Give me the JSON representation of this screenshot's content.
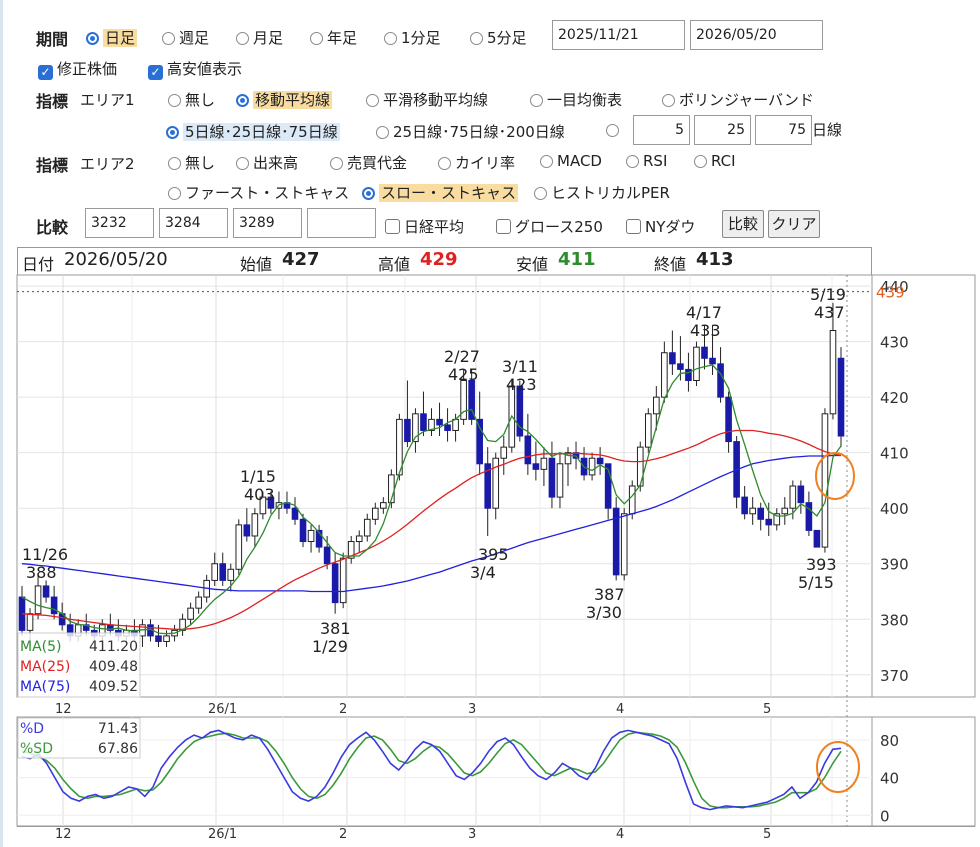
{
  "period": {
    "label": "期間",
    "options": [
      "日足",
      "週足",
      "月足",
      "年足",
      "1分足",
      "5分足"
    ],
    "selected": 0,
    "date_from": "2025/11/21",
    "date_to": "2026/05/20"
  },
  "checks": [
    {
      "label": "修正株価",
      "checked": true
    },
    {
      "label": "高安値表示",
      "checked": true
    }
  ],
  "area1": {
    "label": "指標",
    "sub": "エリア1",
    "options": [
      "無し",
      "移動平均線",
      "平滑移動平均線",
      "一目均衡表",
      "ボリンジャーバンド"
    ],
    "selected": 1,
    "ma_options": [
      "5日線･25日線･75日線",
      "25日線･75日線･200日線"
    ],
    "ma_selected": 0,
    "ma_inputs": [
      "5",
      "25",
      "75"
    ],
    "ma_unit": "日線"
  },
  "area2": {
    "label": "指標",
    "sub": "エリア2",
    "options": [
      "無し",
      "出来高",
      "売買代金",
      "カイリ率",
      "MACD",
      "RSI",
      "RCI",
      "ファースト・ストキャス",
      "スロー・ストキャス",
      "ヒストリカルPER"
    ],
    "selected": 8
  },
  "compare": {
    "label": "比較",
    "codes": [
      "3232",
      "3284",
      "3289",
      ""
    ],
    "options": [
      "日経平均",
      "グロース250",
      "NYダウ"
    ],
    "compare_button": "比較",
    "clear_button": "クリア"
  },
  "info": {
    "date_label": "日付",
    "date": "2026/05/20",
    "open_label": "始値",
    "open": "427",
    "high_label": "高値",
    "high": "429",
    "low_label": "安値",
    "low": "411",
    "close_label": "終値",
    "close": "413"
  },
  "colors": {
    "up": "#ffffff",
    "down": "#1a1aa8",
    "ma5": "#2e8b2e",
    "ma25": "#e02020",
    "ma75": "#2020e0",
    "high_red": "#e02020",
    "low_green": "#2e8b2e",
    "highlight_circle": "#f08020",
    "k_line": "#3a3ae0",
    "d_line": "#3a9a3a"
  },
  "chart_data": [
    {
      "type": "candlestick",
      "yticks": [
        370,
        380,
        390,
        400,
        410,
        420,
        430,
        440
      ],
      "ylim": [
        366,
        442
      ],
      "xticks": [
        "12",
        "26/1",
        "2",
        "3",
        "4",
        "5"
      ],
      "current_price_line": "439",
      "annotations": [
        {
          "text": "11/26",
          "value": "388"
        },
        {
          "text": "1/15",
          "value": "403"
        },
        {
          "text": "1/29",
          "value": "381"
        },
        {
          "text": "2/27",
          "value": "425"
        },
        {
          "text": "3/4",
          "value": "395"
        },
        {
          "text": "3/11",
          "value": "423"
        },
        {
          "text": "3/30",
          "value": "387"
        },
        {
          "text": "4/17",
          "value": "433"
        },
        {
          "text": "5/15",
          "value": "393"
        },
        {
          "text": "5/19",
          "value": "437"
        }
      ],
      "legend": [
        {
          "name": "MA(5)",
          "value": "411.20"
        },
        {
          "name": "MA(25)",
          "value": "409.48"
        },
        {
          "name": "MA(75)",
          "value": "409.52"
        }
      ],
      "candles": [
        [
          384,
          386,
          377,
          378
        ],
        [
          378,
          382,
          376,
          381
        ],
        [
          381,
          388,
          380,
          386
        ],
        [
          386,
          387,
          383,
          384
        ],
        [
          384,
          386,
          380,
          381
        ],
        [
          381,
          383,
          378,
          379
        ],
        [
          379,
          381,
          376,
          377
        ],
        [
          377,
          380,
          376,
          379
        ],
        [
          379,
          381,
          377,
          378
        ],
        [
          378,
          379,
          376,
          377
        ],
        [
          377,
          380,
          376,
          379
        ],
        [
          379,
          381,
          377,
          378
        ],
        [
          378,
          380,
          376,
          377
        ],
        [
          377,
          379,
          376,
          378
        ],
        [
          378,
          380,
          376,
          377
        ],
        [
          377,
          380,
          375,
          379
        ],
        [
          379,
          380,
          376,
          377
        ],
        [
          377,
          379,
          375,
          376
        ],
        [
          376,
          378,
          375,
          377
        ],
        [
          377,
          379,
          376,
          378
        ],
        [
          378,
          381,
          377,
          380
        ],
        [
          380,
          383,
          379,
          382
        ],
        [
          382,
          385,
          381,
          384
        ],
        [
          384,
          388,
          383,
          387
        ],
        [
          387,
          392,
          386,
          390
        ],
        [
          390,
          392,
          386,
          387
        ],
        [
          387,
          390,
          385,
          389
        ],
        [
          389,
          398,
          388,
          397
        ],
        [
          397,
          400,
          394,
          395
        ],
        [
          395,
          400,
          393,
          399
        ],
        [
          399,
          403,
          398,
          402
        ],
        [
          402,
          403,
          399,
          400
        ],
        [
          400,
          403,
          398,
          401
        ],
        [
          401,
          403,
          399,
          400
        ],
        [
          400,
          402,
          397,
          398
        ],
        [
          398,
          399,
          393,
          394
        ],
        [
          394,
          397,
          392,
          396
        ],
        [
          396,
          397,
          392,
          393
        ],
        [
          393,
          395,
          389,
          390
        ],
        [
          390,
          392,
          381,
          383
        ],
        [
          383,
          392,
          382,
          391
        ],
        [
          391,
          395,
          390,
          394
        ],
        [
          394,
          396,
          392,
          395
        ],
        [
          395,
          399,
          394,
          398
        ],
        [
          398,
          401,
          397,
          400
        ],
        [
          400,
          402,
          399,
          401
        ],
        [
          401,
          407,
          400,
          406
        ],
        [
          406,
          417,
          405,
          416
        ],
        [
          416,
          423,
          411,
          412
        ],
        [
          412,
          418,
          410,
          417
        ],
        [
          417,
          421,
          413,
          414
        ],
        [
          414,
          418,
          413,
          416
        ],
        [
          416,
          419,
          413,
          415
        ],
        [
          415,
          418,
          412,
          414
        ],
        [
          414,
          417,
          412,
          416
        ],
        [
          416,
          425,
          415,
          423
        ],
        [
          423,
          425,
          415,
          416
        ],
        [
          416,
          421,
          406,
          408
        ],
        [
          408,
          411,
          395,
          400
        ],
        [
          400,
          410,
          398,
          409
        ],
        [
          409,
          413,
          406,
          411
        ],
        [
          411,
          423,
          410,
          422
        ],
        [
          422,
          423,
          412,
          413
        ],
        [
          413,
          417,
          406,
          408
        ],
        [
          408,
          412,
          405,
          407
        ],
        [
          407,
          411,
          404,
          409
        ],
        [
          409,
          412,
          400,
          402
        ],
        [
          402,
          410,
          400,
          408
        ],
        [
          408,
          411,
          404,
          410
        ],
        [
          410,
          412,
          407,
          409
        ],
        [
          409,
          411,
          405,
          406
        ],
        [
          406,
          410,
          405,
          409
        ],
        [
          409,
          411,
          406,
          408
        ],
        [
          408,
          407,
          398,
          400
        ],
        [
          400,
          402,
          387,
          388
        ],
        [
          388,
          400,
          387,
          399
        ],
        [
          399,
          405,
          398,
          404
        ],
        [
          404,
          412,
          403,
          411
        ],
        [
          411,
          418,
          410,
          417
        ],
        [
          417,
          422,
          414,
          420
        ],
        [
          420,
          430,
          419,
          428
        ],
        [
          428,
          432,
          424,
          426
        ],
        [
          426,
          431,
          423,
          425
        ],
        [
          425,
          428,
          421,
          423
        ],
        [
          423,
          430,
          422,
          429
        ],
        [
          429,
          433,
          425,
          427
        ],
        [
          427,
          433,
          424,
          426
        ],
        [
          426,
          429,
          419,
          420
        ],
        [
          420,
          421,
          410,
          412
        ],
        [
          412,
          413,
          400,
          402
        ],
        [
          402,
          404,
          398,
          399
        ],
        [
          399,
          402,
          397,
          400
        ],
        [
          400,
          401,
          396,
          398
        ],
        [
          398,
          401,
          395,
          397
        ],
        [
          397,
          400,
          396,
          399
        ],
        [
          399,
          402,
          397,
          400
        ],
        [
          400,
          405,
          398,
          404
        ],
        [
          404,
          405,
          399,
          401
        ],
        [
          401,
          403,
          395,
          396
        ],
        [
          396,
          396,
          393,
          393
        ],
        [
          393,
          418,
          392,
          417
        ],
        [
          417,
          437,
          416,
          432
        ],
        [
          427,
          429,
          411,
          413
        ]
      ],
      "ma5": [
        384.0,
        383.2,
        382.5,
        382.1,
        381.8,
        381.0,
        379.6,
        379.1,
        378.9,
        378.5,
        378.3,
        378.2,
        378.4,
        378.0,
        377.9,
        378.1,
        378.2,
        377.5,
        377.4,
        377.5,
        378.1,
        379.0,
        380.4,
        382.1,
        383.6,
        384.7,
        386.0,
        387.8,
        390.8,
        393.0,
        395.5,
        398.7,
        400.6,
        401.0,
        400.5,
        398.4,
        397.2,
        395.6,
        393.8,
        392.0,
        391.4,
        391.4,
        391.4,
        392.6,
        394.2,
        397.2,
        401.6,
        406.4,
        410.2,
        412.8,
        413.8,
        414.2,
        414.5,
        415.4,
        416.0,
        417.4,
        417.8,
        414.5,
        412.2,
        412.0,
        413.3,
        416.6,
        414.6,
        413.8,
        412.4,
        410.8,
        409.3,
        410.0,
        409.5,
        409.4,
        407.4,
        406.8,
        407.8,
        407.0,
        402.4,
        400.8,
        402.2,
        404.2,
        409.4,
        414.6,
        419.7,
        422.5,
        424.3,
        424.4,
        425.1,
        425.5,
        425.8,
        424.2,
        421.6,
        415.9,
        411.5,
        406.8,
        402.4,
        399.4,
        398.6,
        398.6,
        399.1,
        400.8,
        399.9,
        398.6,
        401.0,
        409.2,
        411.2
      ],
      "ma25": [
        381.0,
        380.9,
        380.8,
        380.7,
        380.5,
        380.3,
        380.0,
        379.8,
        379.6,
        379.4,
        379.2,
        379.0,
        378.9,
        378.8,
        378.7,
        378.6,
        378.5,
        378.4,
        378.3,
        378.2,
        378.2,
        378.3,
        378.5,
        378.8,
        379.2,
        379.7,
        380.3,
        381.0,
        381.8,
        382.7,
        383.6,
        384.5,
        385.4,
        386.3,
        387.1,
        387.8,
        388.5,
        389.2,
        389.8,
        390.3,
        390.8,
        391.4,
        392.0,
        392.6,
        393.3,
        394.1,
        395.0,
        396.0,
        397.1,
        398.3,
        399.5,
        400.6,
        401.7,
        402.7,
        403.6,
        404.6,
        405.5,
        406.2,
        406.8,
        407.4,
        407.9,
        408.5,
        409.0,
        409.3,
        409.6,
        409.8,
        409.8,
        409.8,
        409.8,
        409.9,
        409.8,
        409.7,
        409.6,
        409.3,
        408.8,
        408.5,
        408.4,
        408.4,
        408.6,
        408.9,
        409.3,
        409.8,
        410.3,
        410.8,
        411.4,
        412.1,
        412.8,
        413.4,
        413.8,
        414.0,
        414.0,
        414.0,
        413.8,
        413.5,
        413.3,
        413.0,
        412.6,
        412.1,
        411.5,
        410.8,
        410.2,
        409.8,
        409.5
      ],
      "ma75": [
        390.0,
        389.9,
        389.7,
        389.6,
        389.4,
        389.2,
        389.0,
        388.8,
        388.6,
        388.4,
        388.2,
        388.0,
        387.8,
        387.6,
        387.4,
        387.2,
        387.0,
        386.8,
        386.6,
        386.4,
        386.2,
        386.0,
        385.8,
        385.6,
        385.4,
        385.3,
        385.2,
        385.1,
        385.1,
        385.1,
        385.1,
        385.1,
        385.1,
        385.1,
        385.1,
        385.1,
        385.0,
        385.0,
        385.0,
        385.0,
        385.0,
        385.2,
        385.4,
        385.6,
        385.8,
        386.0,
        386.3,
        386.6,
        386.9,
        387.3,
        387.7,
        388.1,
        388.5,
        389.0,
        389.5,
        390.0,
        390.5,
        390.9,
        391.3,
        391.8,
        392.3,
        392.8,
        393.3,
        393.8,
        394.2,
        394.6,
        395.0,
        395.4,
        395.8,
        396.2,
        396.6,
        397.0,
        397.4,
        397.8,
        398.2,
        398.6,
        399.0,
        399.4,
        399.8,
        400.3,
        400.9,
        401.5,
        402.2,
        402.9,
        403.6,
        404.3,
        405.0,
        405.7,
        406.3,
        406.9,
        407.5,
        408.0,
        408.3,
        408.6,
        408.8,
        409.0,
        409.2,
        409.3,
        409.4,
        409.4,
        409.4,
        409.5,
        409.5
      ]
    },
    {
      "type": "line",
      "title": "スロー・ストキャス",
      "yticks": [
        0,
        40,
        80
      ],
      "ylim": [
        -5,
        100
      ],
      "xticks": [
        "12",
        "26/1",
        "2",
        "3",
        "4",
        "5"
      ],
      "legend": [
        {
          "name": "%D",
          "value": "71.43"
        },
        {
          "name": "%SD",
          "value": "67.86"
        }
      ],
      "series": [
        {
          "name": "%D",
          "values": [
            62,
            60,
            65,
            55,
            40,
            25,
            18,
            15,
            20,
            22,
            18,
            20,
            25,
            30,
            28,
            20,
            30,
            50,
            62,
            72,
            80,
            85,
            82,
            88,
            90,
            86,
            82,
            80,
            85,
            82,
            70,
            55,
            40,
            25,
            18,
            15,
            20,
            30,
            45,
            62,
            75,
            82,
            88,
            80,
            68,
            55,
            48,
            58,
            70,
            78,
            75,
            68,
            55,
            42,
            38,
            45,
            55,
            68,
            78,
            82,
            75,
            62,
            50,
            42,
            38,
            45,
            55,
            50,
            42,
            38,
            50,
            68,
            82,
            88,
            90,
            88,
            86,
            84,
            80,
            76,
            60,
            35,
            12,
            8,
            6,
            8,
            10,
            9,
            8,
            10,
            12,
            14,
            18,
            22,
            30,
            18,
            24,
            35,
            55,
            70,
            71
          ]
        },
        {
          "name": "%SD",
          "values": [
            68,
            66,
            62,
            58,
            50,
            38,
            28,
            20,
            18,
            20,
            20,
            21,
            22,
            25,
            28,
            26,
            27,
            35,
            47,
            60,
            70,
            78,
            82,
            84,
            86,
            87,
            85,
            82,
            82,
            82,
            78,
            68,
            55,
            40,
            28,
            20,
            18,
            22,
            32,
            45,
            60,
            72,
            82,
            84,
            80,
            70,
            58,
            55,
            60,
            68,
            74,
            72,
            65,
            55,
            45,
            42,
            46,
            55,
            66,
            76,
            80,
            75,
            65,
            55,
            45,
            42,
            46,
            50,
            48,
            44,
            46,
            55,
            68,
            80,
            86,
            88,
            87,
            86,
            84,
            80,
            72,
            56,
            36,
            18,
            10,
            8,
            8,
            9,
            9,
            9,
            10,
            12,
            14,
            18,
            24,
            24,
            24,
            28,
            40,
            55,
            67.86
          ]
        }
      ]
    }
  ]
}
